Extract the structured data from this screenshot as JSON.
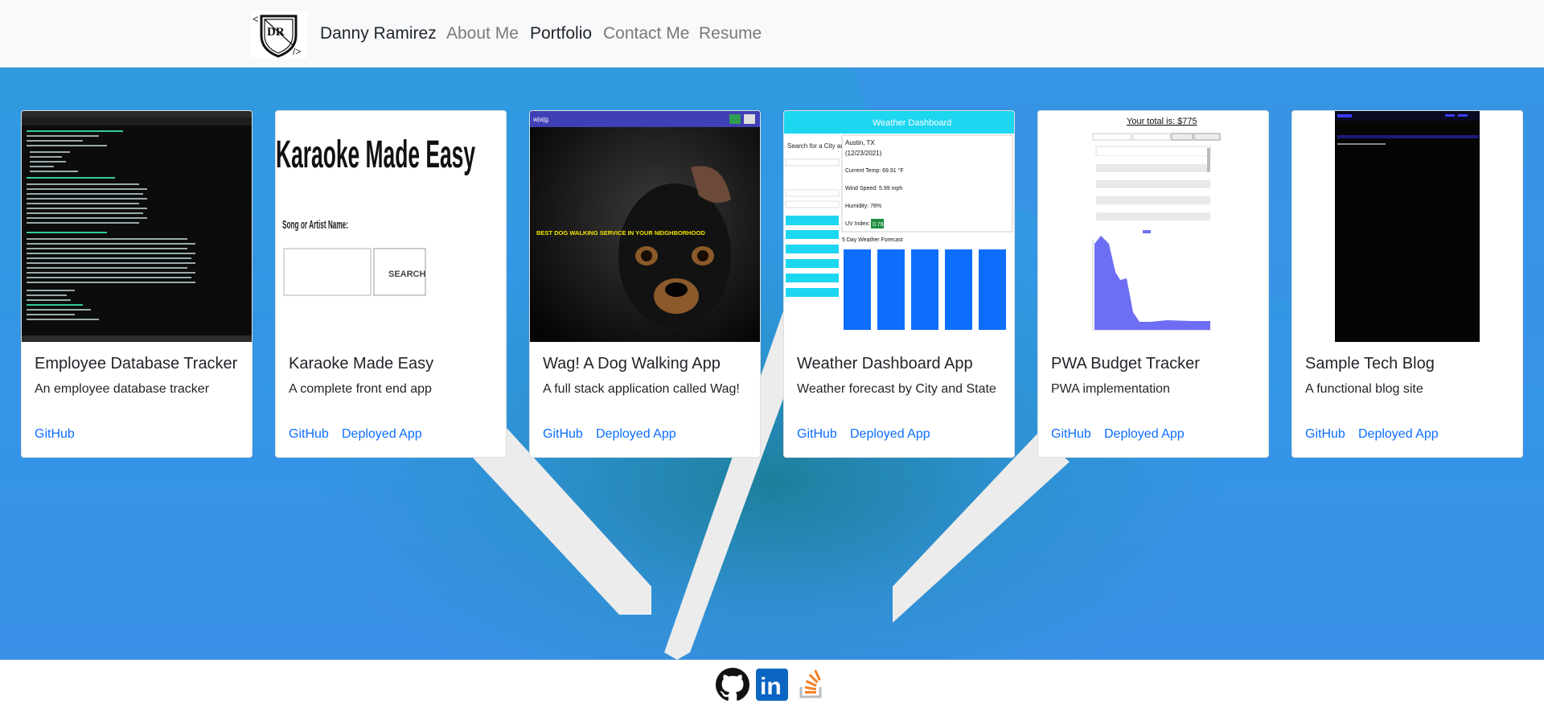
{
  "nav": {
    "logo_text": "DR",
    "brand": "Danny Ramirez",
    "links": [
      "About Me",
      "Portfolio",
      "Contact Me",
      "Resume"
    ],
    "active": "Portfolio"
  },
  "colors": {
    "nav_bg": "#f8f9fa",
    "link": "#0d6efd",
    "bg_blue": "#3595e6",
    "linkedin": "#0a66c2",
    "stackoverflow": "#f48024"
  },
  "cards": [
    {
      "title": "Employee Database Tracker",
      "text": "An employee database tracker",
      "links": [
        "GitHub"
      ],
      "thumb": "terminal-screenshot"
    },
    {
      "title": "Karaoke Made Easy",
      "text": "A complete front end app",
      "links": [
        "GitHub",
        "Deployed App"
      ],
      "thumb": "karaoke-screenshot",
      "thumb_text": {
        "heading": "Karaoke Made Easy",
        "label": "Song or Artist Name:",
        "button": "SEARCH"
      }
    },
    {
      "title": "Wag! A Dog Walking App",
      "text": "A full stack application called Wag!",
      "links": [
        "GitHub",
        "Deployed App"
      ],
      "thumb": "dog-photo",
      "thumb_text": {
        "banner": "BEST DOG WALKING SERVICE IN YOUR NEIGHBORHOOD",
        "logo": "w|a|g"
      }
    },
    {
      "title": "Weather Dashboard App",
      "text": "Weather forecast by City and State",
      "links": [
        "GitHub",
        "Deployed App"
      ],
      "thumb": "weather-screenshot",
      "thumb_text": {
        "header": "Weather Dashboard",
        "search": "Search for a City and State",
        "city": "Austin, TX",
        "date": "(12/23/2021)",
        "temp": "Current Temp: 69.91 °F",
        "wind": "Wind Speed: 5.99 mph",
        "humidity": "Humidity: 78%",
        "uv_label": "UV Index:",
        "uv": "0.76",
        "forecast": "5 Day Weather Forecast"
      }
    },
    {
      "title": "PWA Budget Tracker",
      "text": "PWA implementation",
      "links": [
        "GitHub",
        "Deployed App"
      ],
      "thumb": "budget-screenshot",
      "thumb_text": {
        "total": "Your total is: $775"
      }
    },
    {
      "title": "Sample Tech Blog",
      "text": "A functional blog site",
      "links": [
        "GitHub",
        "Deployed App"
      ],
      "thumb": "blog-screenshot"
    }
  ],
  "footer": {
    "icons": [
      "github-icon",
      "linkedin-icon",
      "stackoverflow-icon"
    ],
    "linkedin_text": "in"
  }
}
